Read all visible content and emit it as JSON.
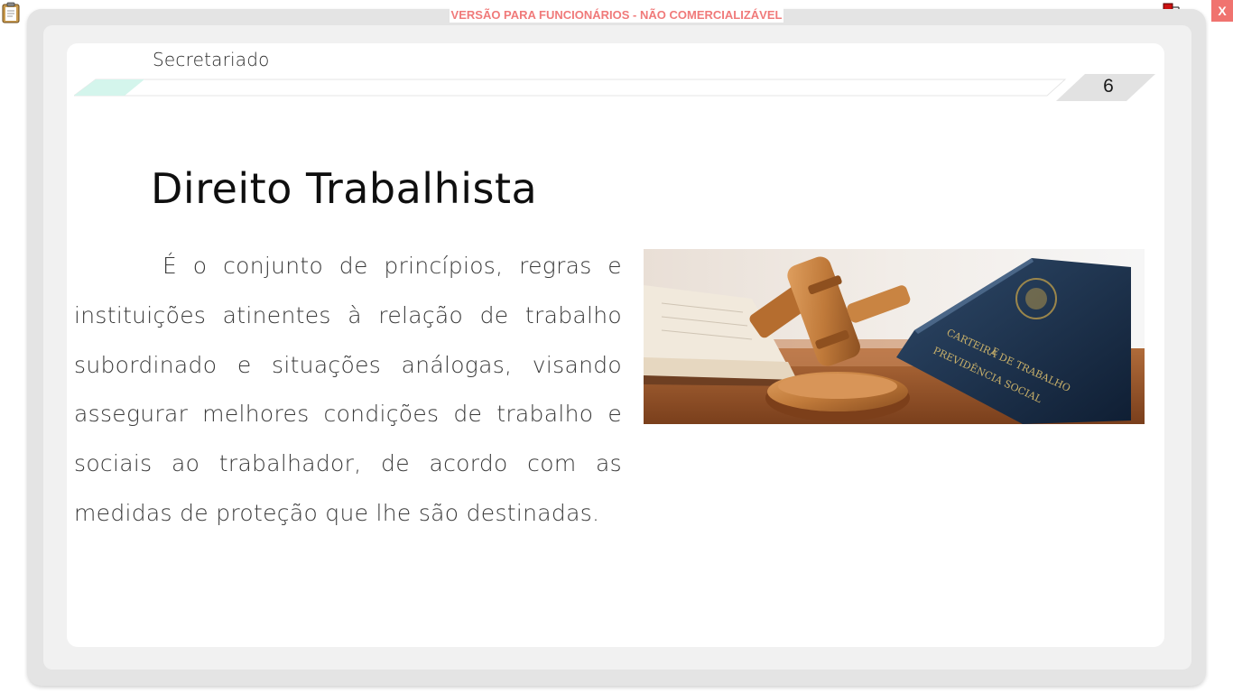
{
  "window": {
    "watermark": "VERSÃO PARA FUNCIONÁRIOS - NÃO COMERCIALIZÁVEL",
    "close_label": "X"
  },
  "page": {
    "section": "Secretariado",
    "number": "6",
    "title": "Direito Trabalhista",
    "body": "É o conjunto de princípios, regras e instituições atinentes à relação de trabalho subordinado e situações análogas, visando assegurar melhores condições de trabalho e sociais ao trabalhador, de acordo com as medidas de proteção que lhe são destinadas.",
    "image": {
      "description_icon": "gavel-and-work-card-image",
      "passport_text": [
        "CARTEIRA DE TRABALHO",
        "E",
        "PREVIDÊNCIA SOCIAL"
      ]
    }
  },
  "colors": {
    "accent_mint": "#cdf3ea",
    "watermark_red": "#f07a7a",
    "close_red": "#f0736f",
    "frame_gray": "#e4e4e4"
  }
}
